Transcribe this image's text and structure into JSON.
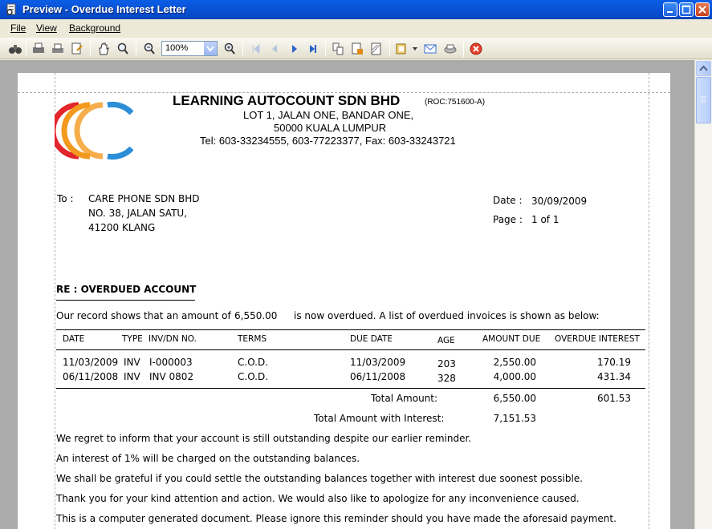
{
  "window": {
    "title": "Preview - Overdue Interest Letter"
  },
  "menu": {
    "file": "File",
    "view": "View",
    "background": "Background"
  },
  "toolbar": {
    "zoom": "100%"
  },
  "company": {
    "name": "LEARNING AUTOCOUNT SDN BHD",
    "roc": "(ROC:751600-A)",
    "address1": "LOT 1, JALAN ONE,  BANDAR ONE,",
    "address2": "50000  KUALA LUMPUR",
    "contact": "Tel:  603-33234555,  603-77223377,  Fax: 603-33243721",
    "logo_colors": {
      "red": "#e3262b",
      "orange": "#f39a1e",
      "blue": "#2b8ed6"
    }
  },
  "recipient": {
    "to_label": "To :",
    "name": "CARE PHONE SDN BHD",
    "line2": "NO. 38, JALAN SATU,",
    "line3": "41200 KLANG"
  },
  "meta": {
    "date_label": "Date :",
    "date": "30/09/2009",
    "page_label": "Page :",
    "page": "1 of 1"
  },
  "letter": {
    "subject": "RE : OVERDUED ACCOUNT",
    "intro_prefix": "Our record shows that an amount of",
    "intro_amount": "6,550.00",
    "intro_suffix": "is now overdued. A list of overdued invoices is shown as below:"
  },
  "table": {
    "headers": [
      "DATE",
      "TYPE",
      "INV/DN NO.",
      "TERMS",
      "DUE DATE",
      "AGE",
      "AMOUNT DUE",
      "OVERDUE INTEREST"
    ],
    "rows": [
      [
        "11/03/2009",
        "INV",
        "I-000003",
        "C.O.D.",
        "11/03/2009",
        "203",
        "2,550.00",
        "170.19"
      ],
      [
        "06/11/2008",
        "INV",
        "INV 0802",
        "C.O.D.",
        "06/11/2008",
        "328",
        "4,000.00",
        "431.34"
      ]
    ],
    "total_label": "Total Amount:",
    "total_amount": "6,550.00",
    "total_interest": "601.53",
    "total_with_interest_label": "Total Amount with Interest:",
    "total_with_interest": "7,151.53"
  },
  "paragraphs": [
    "We regret to inform that your account is still outstanding despite our earlier reminder.",
    "An interest of 1% will be charged on the outstanding balances.",
    "We shall be grateful if you could settle the outstanding balances together with interest due soonest possible.",
    "Thank you for your kind attention and action. We would also like to apologize for any inconvenience caused.",
    "This is a computer generated document. Please ignore this reminder should you have made the aforesaid payment."
  ]
}
